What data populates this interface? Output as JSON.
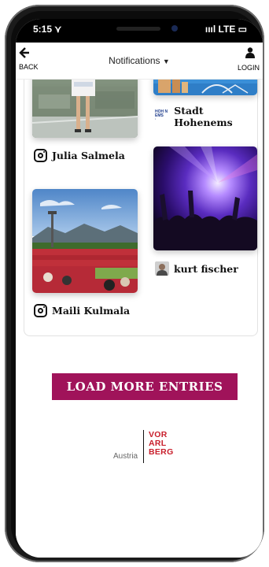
{
  "status_bar": {
    "time": "5:15 ⋎",
    "signal": "ıııl LTE ▭"
  },
  "header": {
    "back_label": "BACK",
    "title": "Notifications",
    "login_label": "LOGIN"
  },
  "posts": [
    {
      "source_icon": "instagram-icon",
      "author": "Julia Salmela"
    },
    {
      "source_icon": "logo-icon",
      "author": "Stadt Hohenems"
    },
    {
      "source_icon": "avatar-icon",
      "author": "kurt fischer"
    },
    {
      "source_icon": "instagram-icon",
      "author": "Maili Kulmala"
    }
  ],
  "load_more_label": "LOAD MORE ENTRIES",
  "brand": {
    "country": "Austria",
    "line1": "VOR",
    "line2": "ARL",
    "line3": "BERG"
  },
  "colors": {
    "accent": "#a0135a",
    "brand_red": "#c81e2b"
  }
}
